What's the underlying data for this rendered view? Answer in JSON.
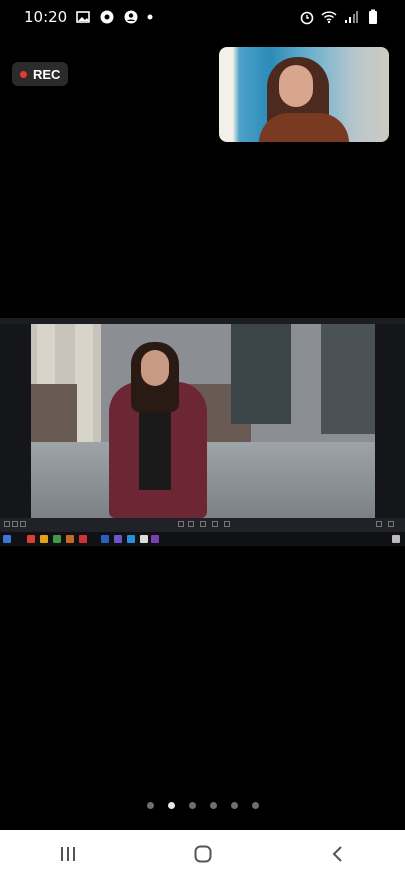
{
  "status_bar": {
    "time": "10:20",
    "icons_left": [
      "image-icon",
      "chrome-icon",
      "account-icon",
      "dot-icon"
    ],
    "icons_right": [
      "alarm-icon",
      "wifi-icon",
      "signal-icon",
      "battery-icon"
    ]
  },
  "recording": {
    "label": "REC",
    "color": "#e53935"
  },
  "self_view": {
    "icon": "participant-video"
  },
  "screen_share": {
    "icon": "shared-screen-video"
  },
  "pager": {
    "count": 6,
    "active_index": 1
  },
  "nav_bar": {
    "buttons": [
      "recent-apps-icon",
      "home-icon",
      "back-icon"
    ]
  }
}
